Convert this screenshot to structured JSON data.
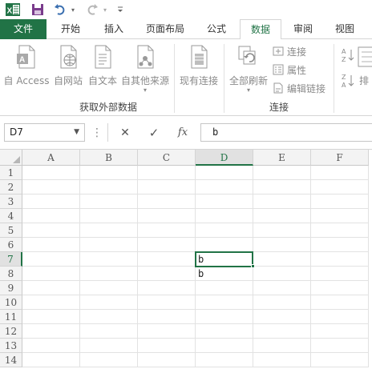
{
  "app": {
    "accent": "#217346",
    "icons": [
      "excel-logo-icon",
      "save-icon",
      "undo-icon",
      "redo-icon",
      "customize-qat-icon"
    ]
  },
  "tabs": [
    {
      "label": "文件",
      "active": false
    },
    {
      "label": "开始",
      "active": false
    },
    {
      "label": "插入",
      "active": false
    },
    {
      "label": "页面布局",
      "active": false
    },
    {
      "label": "公式",
      "active": false
    },
    {
      "label": "数据",
      "active": true
    },
    {
      "label": "审阅",
      "active": false
    },
    {
      "label": "视图",
      "active": false
    }
  ],
  "ribbon": {
    "get_external": {
      "buttons": [
        "自 Access",
        "自网站",
        "自文本",
        "自其他来源"
      ],
      "group_label": "获取外部数据"
    },
    "existing_connections": "现有连接",
    "connections": {
      "refresh_all": "全部刷新",
      "connections": "连接",
      "properties": "属性",
      "edit_links": "编辑链接",
      "group_label": "连接"
    },
    "sort_partial": "排"
  },
  "formula_bar": {
    "name_box": "D7",
    "cancel_glyph": "✕",
    "enter_glyph": "✓",
    "fx_label": "fx",
    "value": "b"
  },
  "sheet": {
    "columns": [
      "A",
      "B",
      "C",
      "D",
      "E",
      "F"
    ],
    "rows": [
      "1",
      "2",
      "3",
      "4",
      "5",
      "6",
      "7",
      "8",
      "9",
      "10",
      "11",
      "12",
      "13",
      "14"
    ],
    "selected_column": "D",
    "selected_row": "7",
    "cells": {
      "D7": "b",
      "D8": "b"
    }
  }
}
